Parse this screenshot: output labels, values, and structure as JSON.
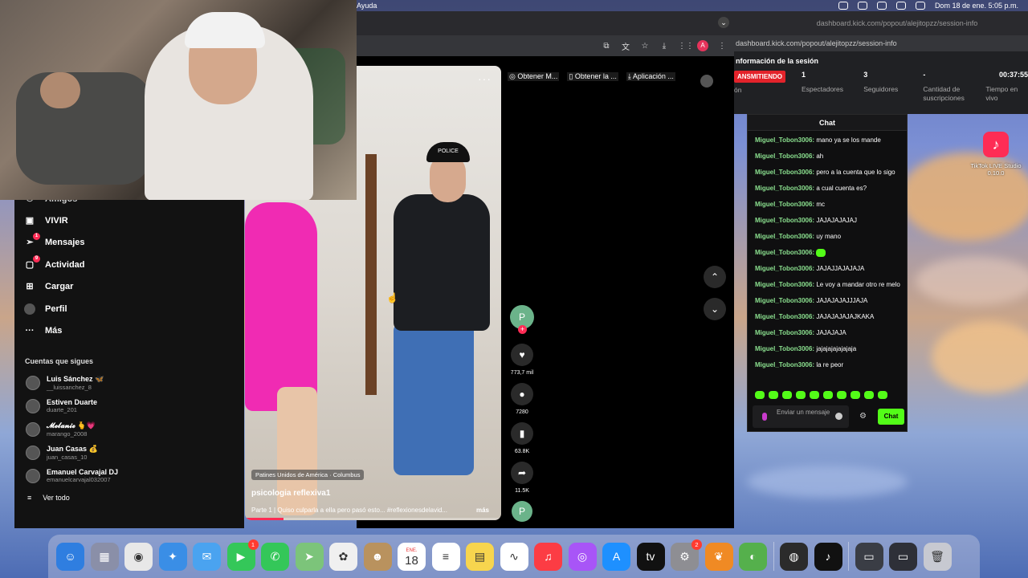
{
  "menubar": {
    "menu_help": "Ayuda",
    "datetime": "Dom 18 de ene.  5:05 p.m."
  },
  "browser_main": {
    "toolbar_icons": [
      "cast-icon",
      "translate-icon",
      "star-icon",
      "download-icon",
      "extensions-icon",
      "profile-icon"
    ],
    "profile_initial": "A"
  },
  "popout": {
    "title_url": "dashboard.kick.com/popout/alejitopzz/session-info",
    "address": "dashboard.kick.com/popout/alejitopzz/session-info",
    "section_title": "nformación de la sesión",
    "live_badge": "ANSMITIENDO",
    "live_badge_sub": "ón",
    "stats": [
      {
        "value": "1",
        "label": "Espectadores"
      },
      {
        "value": "3",
        "label": "Seguidores"
      },
      {
        "value": "-",
        "label": "Cantidad de suscripciones"
      },
      {
        "value": "00:37:55",
        "label": "Tiempo en vivo"
      }
    ]
  },
  "tiktok": {
    "nav": [
      {
        "label": "Amigos",
        "icon": "friends-icon"
      },
      {
        "label": "VIVIR",
        "icon": "live-icon"
      },
      {
        "label": "Mensajes",
        "icon": "messages-icon",
        "badge": "1"
      },
      {
        "label": "Actividad",
        "icon": "activity-icon",
        "badge": "9"
      },
      {
        "label": "Cargar",
        "icon": "upload-icon"
      },
      {
        "label": "Perfil",
        "icon": "profile-icon"
      },
      {
        "label": "Más",
        "icon": "more-icon"
      }
    ],
    "following_title": "Cuentas que sigues",
    "following": [
      {
        "name": "Luis Sánchez 🦋",
        "handle": "__luissanchez_8"
      },
      {
        "name": "Estiven Duarte",
        "handle": "duarte_201"
      },
      {
        "name": "𝓜𝓮𝓵𝓪𝓷𝓲𝓮 🫰💗",
        "handle": "marango_2008"
      },
      {
        "name": "Juan Casas 💰",
        "handle": "juan_casas_10"
      },
      {
        "name": "Emanuel Carvajal DJ",
        "handle": "emanuelcarvajal032007"
      }
    ],
    "see_all": "Ver todo",
    "top_actions": [
      "Obtener M...",
      "Obtener la ...",
      "Aplicación ..."
    ],
    "video": {
      "location": "Patines Unidos de América · Columbus",
      "title": "psicologia reflexiva1",
      "caption": "Parte 1 | Quiso culparla a ella pero pasó esto... #reflexionesdelavid...",
      "more": "más",
      "progress": 0.15,
      "cap_text": "POLICE"
    },
    "side": {
      "likes": "773,7 mil",
      "comments": "7280",
      "saves": "63.8K",
      "shares": "11.5K"
    }
  },
  "chat": {
    "header": "Chat",
    "messages": [
      {
        "user": "Miguel_Tobon3006:",
        "text": "mano ya se los mande"
      },
      {
        "user": "Miguel_Tobon3006:",
        "text": "ah"
      },
      {
        "user": "Miguel_Tobon3006:",
        "text": "pero a la cuenta que lo sigo"
      },
      {
        "user": "Miguel_Tobon3006:",
        "text": "a cual cuenta es?"
      },
      {
        "user": "Miguel_Tobon3006:",
        "text": "mc"
      },
      {
        "user": "Miguel_Tobon3006:",
        "text": "JAJAJAJAJAJ"
      },
      {
        "user": "Miguel_Tobon3006:",
        "text": "uy mano"
      },
      {
        "user": "Miguel_Tobon3006:",
        "text": ""
      },
      {
        "user": "Miguel_Tobon3006:",
        "text": "JAJAJJAJAJAJA"
      },
      {
        "user": "Miguel_Tobon3006:",
        "text": "Le voy a mandar otro re melo"
      },
      {
        "user": "Miguel_Tobon3006:",
        "text": "JAJAJAJAJJJAJA"
      },
      {
        "user": "Miguel_Tobon3006:",
        "text": "JAJAJAJAJAJKAKA"
      },
      {
        "user": "Miguel_Tobon3006:",
        "text": "JAJAJAJA"
      },
      {
        "user": "Miguel_Tobon3006:",
        "text": "jajajajajajajaja"
      },
      {
        "user": "Miguel_Tobon3006:",
        "text": "la re peor"
      }
    ],
    "input_placeholder": "Enviar un mensaje",
    "send": "Chat"
  },
  "desktop_icon": {
    "label": "TikTok LIVE Studio 0.10.0"
  },
  "dock": {
    "apps": [
      {
        "name": "finder-icon",
        "color": "#2f7ee0",
        "glyph": "☺"
      },
      {
        "name": "launchpad-icon",
        "color": "#8a8fa8",
        "glyph": "▦"
      },
      {
        "name": "chrome-icon",
        "color": "#e8e8e8",
        "glyph": "◉"
      },
      {
        "name": "safari-icon",
        "color": "#3a8ee6",
        "glyph": "✦"
      },
      {
        "name": "mail-icon",
        "color": "#4aa3f0",
        "glyph": "✉"
      },
      {
        "name": "facetime-icon",
        "color": "#34c759",
        "glyph": "▶",
        "badge": "1"
      },
      {
        "name": "messages-icon",
        "color": "#34c759",
        "glyph": "✆"
      },
      {
        "name": "maps-icon",
        "color": "#7cc47a",
        "glyph": "➤"
      },
      {
        "name": "photos-icon",
        "color": "#f0f0f0",
        "glyph": "✿"
      },
      {
        "name": "contacts-icon",
        "color": "#b9925e",
        "glyph": "☻"
      },
      {
        "name": "calendar-icon",
        "color": "#ffffff",
        "glyph": "18",
        "sub": "ENE."
      },
      {
        "name": "reminders-icon",
        "color": "#ffffff",
        "glyph": "≡"
      },
      {
        "name": "notes-icon",
        "color": "#f7d54e",
        "glyph": "▤"
      },
      {
        "name": "freeform-icon",
        "color": "#ffffff",
        "glyph": "∿"
      },
      {
        "name": "music-icon",
        "color": "#fc3c44",
        "glyph": "♫"
      },
      {
        "name": "podcasts-icon",
        "color": "#a855f7",
        "glyph": "◎"
      },
      {
        "name": "appstore-icon",
        "color": "#1e90ff",
        "glyph": "A"
      },
      {
        "name": "appletv-icon",
        "color": "#111111",
        "glyph": "tv"
      },
      {
        "name": "settings-icon",
        "color": "#8e8e93",
        "glyph": "⚙",
        "badge": "2"
      },
      {
        "name": "fl-studio-icon",
        "color": "#f08a24",
        "glyph": "❦"
      },
      {
        "name": "capcut-icon",
        "color": "#55b04c",
        "glyph": "◐"
      },
      {
        "name": "obs-icon",
        "color": "#2b2b2b",
        "glyph": "◍"
      },
      {
        "name": "tiktok-icon",
        "color": "#111111",
        "glyph": "♪"
      },
      {
        "name": "window-thumb-1-icon",
        "color": "#3a3d45",
        "glyph": "▭"
      },
      {
        "name": "window-thumb-2-icon",
        "color": "#2e3038",
        "glyph": "▭"
      },
      {
        "name": "trash-icon",
        "color": "#c7c9d1",
        "glyph": "🗑"
      }
    ]
  }
}
